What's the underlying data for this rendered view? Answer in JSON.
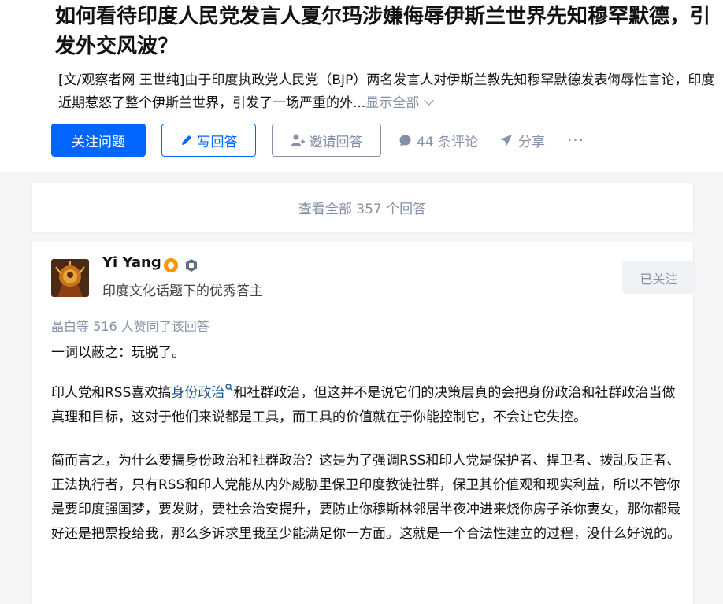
{
  "question": {
    "title": "如何看待印度人民党发言人夏尔玛涉嫌侮辱伊斯兰世界先知穆罕默德，引发外交风波？",
    "description": "[文/观察者网 王世纯]由于印度执政党人民党（BJP）两名发言人对伊斯兰教先知穆罕默德发表侮辱性言论，印度近期惹怒了整个伊斯兰世界，引发了一场严重的外...",
    "show_all_label": "显示全部"
  },
  "actions": {
    "follow_label": "关注问题",
    "write_label": "写回答",
    "invite_label": "邀请回答",
    "comments_label": "44 条评论",
    "share_label": "分享",
    "more_label": "···"
  },
  "all_answers_label": "查看全部 357 个回答",
  "answer": {
    "author_name": "Yi Yang",
    "author_headline": "印度文化话题下的优秀答主",
    "followed_label": "已关注",
    "voters_text": "晶白等 516 人赞同了该回答",
    "paragraph1": "一词以蔽之：玩脱了。",
    "p2_before": "印人党和RSS喜欢搞",
    "p2_link": "身份政治",
    "p2_after": "和社群政治，但这并不是说它们的决策层真的会把身份政治和社群政治当做真理和目标，这对于他们来说都是工具，而工具的价值就在于你能控制它，不会让它失控。",
    "paragraph3": "简而言之，为什么要搞身份政治和社群政治？这是为了强调RSS和印人党是保护者、捍卫者、拨乱反正者、正法执行者，只有RSS和印人党能从内外威胁里保卫印度教徒社群，保卫其价值观和现实利益，所以不管你是要印度强国梦，要发财，要社会治安提升，要防止你穆斯林邻居半夜冲进来烧你房子杀你妻女，那你都最好还是把票投给我，那么多诉求里我至少能满足你一方面。这就是一个合法性建立的过程，没什么好说的。"
  },
  "colors": {
    "brand": "#0066ff",
    "muted": "#8590a6",
    "link": "#175199",
    "badge_orange": "#ff9607"
  },
  "icons": [
    "pencil-icon",
    "invite-icon",
    "comment-icon",
    "share-icon",
    "chevron-down-icon",
    "search-icon",
    "badge-icon"
  ]
}
